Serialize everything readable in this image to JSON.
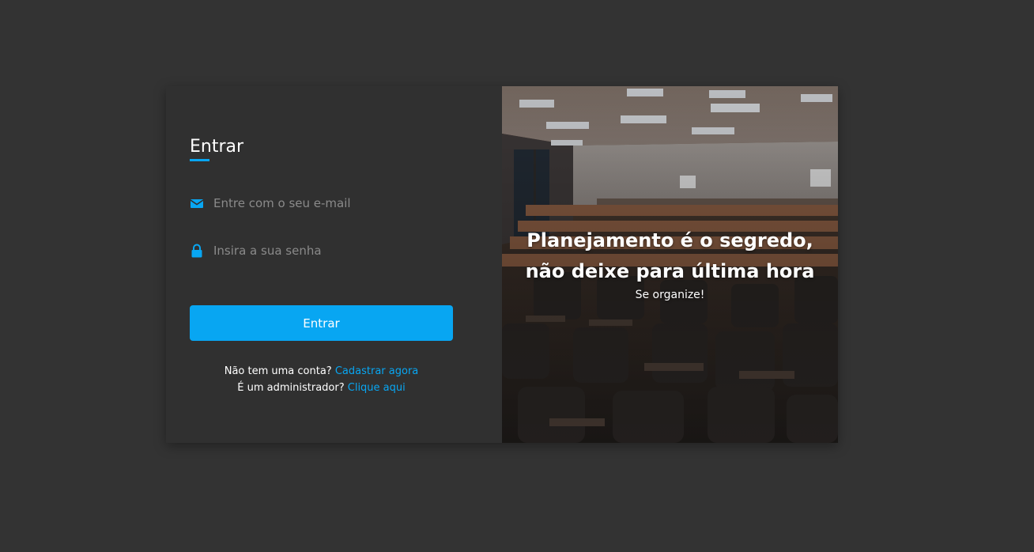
{
  "login": {
    "title": "Entrar",
    "email_placeholder": "Entre com o seu e-mail",
    "password_placeholder": "Insira a sua senha",
    "submit_label": "Entrar",
    "signup_prompt": "Não tem uma conta?",
    "signup_link": "Cadastrar agora",
    "admin_prompt": "É um administrador?",
    "admin_link": "Clique aqui"
  },
  "hero": {
    "headline_line1": "Planejamento é o segredo,",
    "headline_line2": "não deixe para última hora",
    "subtitle": "Se organize!"
  },
  "icons": {
    "email": "envelope-icon",
    "password": "lock-icon"
  },
  "colors": {
    "page_background": "#333333",
    "card_background": "#303030",
    "accent": "#08a6f2",
    "text": "#ffffff",
    "placeholder": "#8a8a8a"
  }
}
